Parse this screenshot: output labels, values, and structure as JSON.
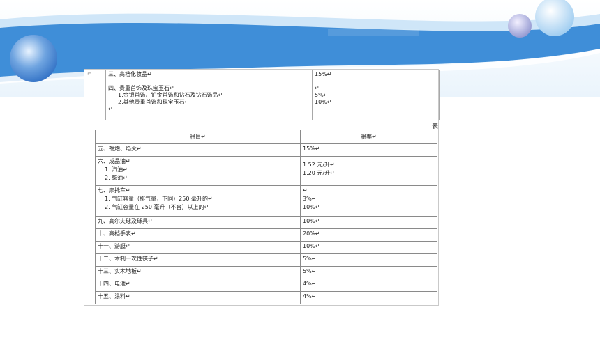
{
  "table1": {
    "rows": [
      {
        "item": "三、高档化妆品↵",
        "rate": "15%↵"
      },
      {
        "item": "四、贵重首饰及珠宝玉石↵",
        "sub": [
          "1.金银首饰、铂金首饰和钻石及钻石饰品↵",
          "2.其他贵重首饰和珠宝玉石↵"
        ],
        "rates": [
          "↵",
          "5%↵",
          "10%↵"
        ]
      }
    ]
  },
  "caption": "表",
  "table2": {
    "header": {
      "item": "税目↵",
      "rate": "税率↵"
    },
    "rows": [
      {
        "item": "五、鞭炮、焰火↵",
        "rates": [
          "15%↵"
        ]
      },
      {
        "item": "六、成品油↵",
        "sub": [
          "1. 汽油↵",
          "2. 柴油↵"
        ],
        "rates": [
          "1.52 元/升↵",
          "1.20 元/升↵"
        ]
      },
      {
        "item": "七、摩托车↵",
        "sub": [
          "1. 气缸容量（排气量，下同）250 毫升的↵",
          "2. 气缸容量在 250 毫升（不含）以上的↵"
        ],
        "rates": [
          "↵",
          "3%↵",
          "10%↵"
        ]
      },
      {
        "item": "九、高尔夫球及球具↵",
        "rates": [
          "10%↵"
        ]
      },
      {
        "item": "十、高档手表↵",
        "rates": [
          "20%↵"
        ]
      },
      {
        "item": "十一、游艇↵",
        "rates": [
          "10%↵"
        ]
      },
      {
        "item": "十二、木制一次性筷子↵",
        "rates": [
          "5%↵"
        ]
      },
      {
        "item": "十三、实木地板↵",
        "rates": [
          "5%↵"
        ]
      },
      {
        "item": "十四、电池↵",
        "rates": [
          "4%↵"
        ]
      },
      {
        "item": "十五、涂料↵",
        "rates": [
          "4%↵"
        ]
      }
    ]
  },
  "colors": {
    "band": "#3f8ed8",
    "light": "#cfe6f8",
    "bubble": "#5e98d6"
  }
}
